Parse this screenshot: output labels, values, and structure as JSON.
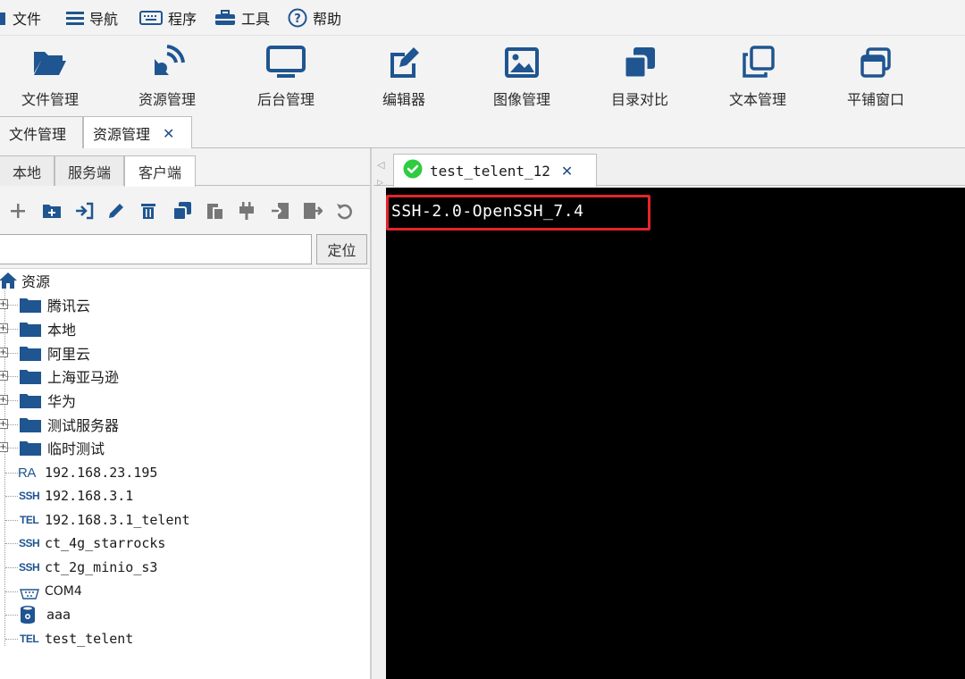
{
  "menu": {
    "file": "文件",
    "nav": "导航",
    "program": "程序",
    "tools": "工具",
    "help": "帮助"
  },
  "toolbar": [
    {
      "label": "文件管理",
      "icon": "folder-open-icon"
    },
    {
      "label": "资源管理",
      "icon": "broadcast-icon"
    },
    {
      "label": "后台管理",
      "icon": "monitor-icon"
    },
    {
      "label": "编辑器",
      "icon": "edit-icon"
    },
    {
      "label": "图像管理",
      "icon": "image-icon"
    },
    {
      "label": "目录对比",
      "icon": "compare-icon"
    },
    {
      "label": "文本管理",
      "icon": "copy-icon"
    },
    {
      "label": "平铺窗口",
      "icon": "windows-icon"
    }
  ],
  "doc_tabs": [
    {
      "label": "文件管理"
    },
    {
      "label": "资源管理",
      "close": "✕"
    }
  ],
  "panel_tabs": [
    "本地",
    "服务端",
    "客户端"
  ],
  "search": {
    "value": "",
    "locate_label": "定位"
  },
  "tree": {
    "root": "资源",
    "folders": [
      "腾讯云",
      "本地",
      "阿里云",
      "上海亚马逊",
      "华为",
      "测试服务器",
      "临时测试"
    ],
    "items": [
      {
        "tag": "RA",
        "label": "192.168.23.195"
      },
      {
        "tag": "SSH",
        "label": "192.168.3.1"
      },
      {
        "tag": "TEL",
        "label": "192.168.3.1_telent"
      },
      {
        "tag": "SSH",
        "label": "ct_4g_starrocks"
      },
      {
        "tag": "SSH",
        "label": "ct_2g_minio_s3"
      },
      {
        "tag": "",
        "label": "COM4"
      },
      {
        "tag": "",
        "label": "aaa"
      },
      {
        "tag": "TEL",
        "label": "test_telent"
      }
    ]
  },
  "session": {
    "tab_title": "test_telent_12",
    "close": "✕",
    "output_line": "SSH-2.0-OpenSSH_7.4"
  },
  "colors": {
    "accent_blue": "#1f5590",
    "highlight_red": "#e3242b",
    "status_green": "#2ecc40",
    "terminal_bg": "#000000"
  }
}
